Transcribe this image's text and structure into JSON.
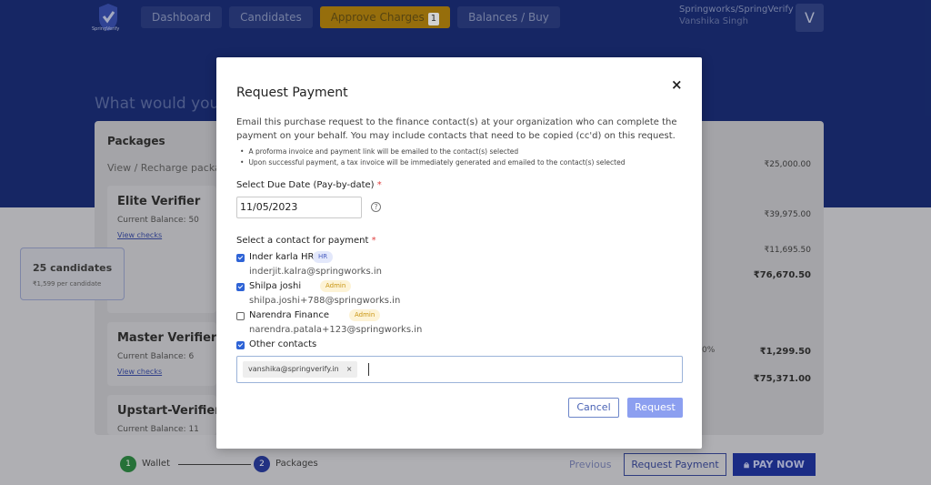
{
  "header": {
    "logo_text": "SpringVerify",
    "nav": [
      {
        "label": "Dashboard"
      },
      {
        "label": "Candidates"
      },
      {
        "label": "Approve Charges",
        "badge": "1"
      },
      {
        "label": "Balances / Buy"
      }
    ],
    "org": "Springworks/SpringVerify",
    "user": "Vanshika Singh",
    "avatar_letter": "V"
  },
  "page": {
    "heading": "What would you",
    "packages_title": "Packages",
    "packages_sub": "View / Recharge packa",
    "cards": [
      {
        "name": "Elite Verifier",
        "balance": "Current Balance: 50",
        "link": "View checks"
      },
      {
        "name": "Master Verifier",
        "balance": "Current Balance: 6",
        "link": "View checks"
      },
      {
        "name": "Upstart-Verifier",
        "balance": "Current Balance: 11"
      }
    ],
    "subcard": {
      "title": "25 candidates",
      "price": "₹1,599  per candidate"
    },
    "amounts": [
      "₹25,000.00",
      "₹39,975.00",
      "₹11,695.50",
      "₹76,670.50",
      "₹1,299.50",
      "₹75,371.00"
    ],
    "pct_fragment": "0%"
  },
  "footer": {
    "step1": {
      "num": "1",
      "label": "Wallet"
    },
    "step2": {
      "num": "2",
      "label": "Packages"
    },
    "previous": "Previous",
    "request_payment": "Request Payment",
    "pay_now": "PAY NOW"
  },
  "modal": {
    "title": "Request Payment",
    "close_glyph": "×",
    "description": "Email this purchase request to the finance contact(s) at your organization who can complete the payment on your behalf. You may include contacts that need to be copied (cc'd) on this request.",
    "bullets": [
      "A proforma invoice and payment link will be emailed to the contact(s) selected",
      "Upon successful payment, a tax invoice will be immediately generated and emailed to the contact(s) selected"
    ],
    "due_date_label": "Select Due Date (Pay-by-date)",
    "due_date_value": "11/05/2023",
    "help_glyph": "?",
    "contact_label": "Select a contact for payment",
    "required_mark": "*",
    "contacts": [
      {
        "name": "Inder karla HR",
        "tag": "HR",
        "email": "inderjit.kalra@springworks.in",
        "checked": true
      },
      {
        "name": "Shilpa joshi",
        "tag": "Admin",
        "email": "shilpa.joshi+788@springworks.in",
        "checked": true
      },
      {
        "name": "Narendra Finance",
        "tag": "Admin",
        "email": "narendra.patala+123@springworks.in",
        "checked": false
      }
    ],
    "other_contacts_label": "Other contacts",
    "other_emails": [
      "vanshika@springverify.in"
    ],
    "chip_remove": "×",
    "cancel_label": "Cancel",
    "request_label": "Request",
    "colors": {
      "primary": "#2e63d6",
      "request_button": "#8c9ff0",
      "hr_tag": "#e3e8fb",
      "admin_tag": "#fdf3d6"
    }
  }
}
